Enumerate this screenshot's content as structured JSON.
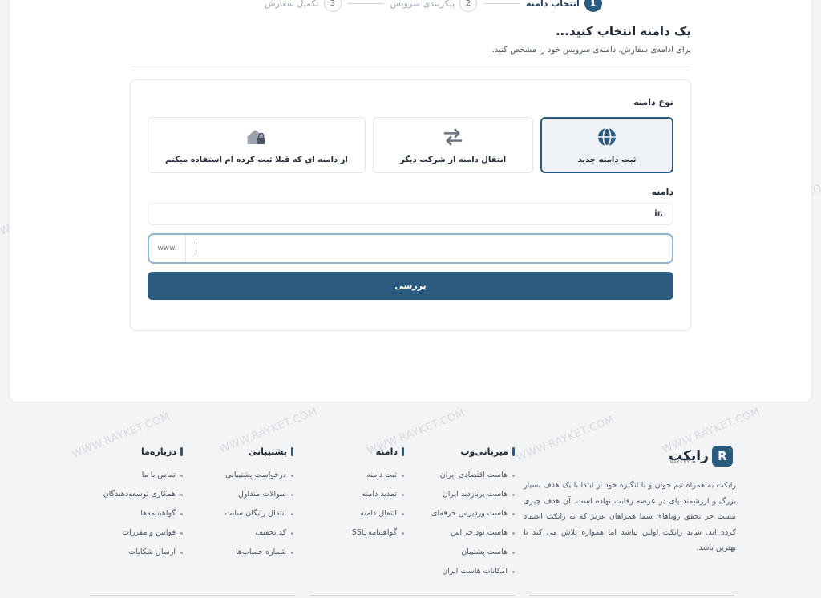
{
  "watermark": "WWW.RAYKET.COM",
  "steps": [
    {
      "num": "1",
      "label": "انتخاب دامنه",
      "active": true
    },
    {
      "num": "2",
      "label": "پیکربندی سرویس",
      "active": false
    },
    {
      "num": "3",
      "label": "تکمیل سفارش",
      "active": false
    }
  ],
  "heading": {
    "title": "یک دامنه انتخاب کنید...",
    "subtitle": "برای ادامه‌ی سفارش، دامنه‌ی سرویس خود را مشخص کنید."
  },
  "domain_type": {
    "label": "نوع دامنه",
    "options": [
      {
        "label": "ثبت دامنه جدید",
        "icon": "globe-icon",
        "selected": true
      },
      {
        "label": "انتقال دامنه از شرکت دیگر",
        "icon": "transfer-arrows-icon",
        "selected": false
      },
      {
        "label": "از دامنه ای که قبلا ثبت کرده ام استفاده میکنم",
        "icon": "house-lock-icon",
        "selected": false
      }
    ]
  },
  "domain": {
    "label": "دامنه",
    "tld": "ir.",
    "prefix": "www.",
    "value": "",
    "check_button": "بررسی"
  },
  "footer": {
    "logo_text": "رایکت",
    "logo_letter": "R",
    "logo_sub": "RAYKET",
    "about": "رایکت به همراه تیم جوان و با انگیزه خود از ابتدا با یک هدف بسیار بزرگ و ارزشمند پای در عرصه رقابت نهاده است. آن هدف چیزی نیست جز تحقق رویاهای شما همراهان عزیز که به رایکت اعتماد کرده اند. شاید رایکت اولین نباشد اما همواره تلاش می کند تا بهترین باشد.",
    "columns": [
      {
        "title": "میزبانی‌وب",
        "items": [
          "هاست اقتصادی ایران",
          "هاست پربازدید ایران",
          "هاست وردپرس حرفه‌ای",
          "هاست نود جی‌اس",
          "هاست پشتیبان",
          "امکانات هاست ایران"
        ]
      },
      {
        "title": "دامنه",
        "items": [
          "ثبت دامنه",
          "تمدید دامنه",
          "انتقال دامنه",
          "گواهینامه SSL"
        ]
      },
      {
        "title": "پشتیبانی",
        "items": [
          "درخواست پشتیبانی",
          "سوالات متداول",
          "انتقال رایگان سایت",
          "کد تخفیف",
          "شماره حساب‌ها"
        ]
      },
      {
        "title": "درباره‌ما",
        "items": [
          "تماس با ما",
          "همکاری توسعه‌دهندگان",
          "گواهینامه‌ها",
          "قوانین و مقررات",
          "ارسال شکایات"
        ]
      }
    ]
  },
  "colors": {
    "primary": "#2a5a7e",
    "background": "#f3f4f6"
  }
}
